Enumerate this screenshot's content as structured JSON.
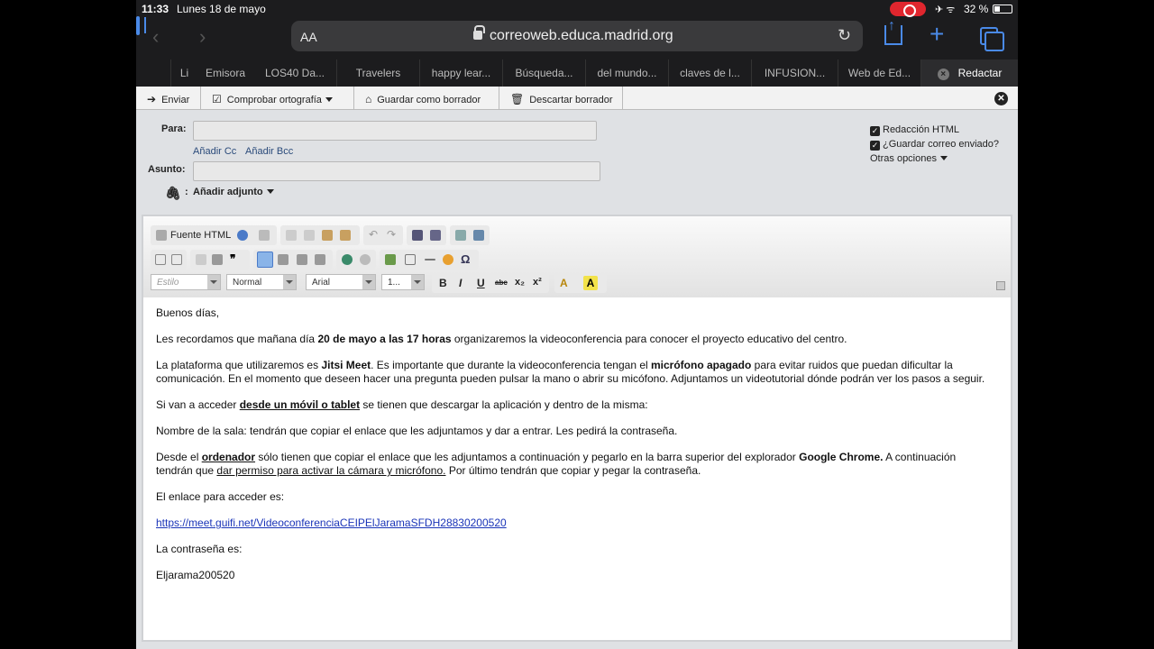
{
  "status": {
    "time": "11:33",
    "date": "Lunes 18 de mayo",
    "battery": "32 %"
  },
  "browser": {
    "aa_label": "AA",
    "url": "correoweb.educa.madrid.org",
    "tabs": [
      "Li",
      "Emisora",
      "LOS40 Da...",
      "Travelers",
      "happy lear...",
      "Búsqueda...",
      "del mundo...",
      "claves de l...",
      "INFUSION...",
      "Web de Ed...",
      "Redactar"
    ]
  },
  "toolbar": {
    "send": "Enviar",
    "spellcheck": "Comprobar ortografía",
    "save_draft": "Guardar como borrador",
    "discard_draft": "Descartar borrador"
  },
  "form": {
    "to_label": "Para:",
    "add_cc": "Añadir Cc",
    "add_bcc": "Añadir Bcc",
    "subject_label": "Asunto:",
    "attach_label": "Añadir adjunto",
    "html_option": "Redacción HTML",
    "save_sent_option": "¿Guardar correo enviado?",
    "other_options": "Otras opciones"
  },
  "editor": {
    "source_html": "Fuente HTML",
    "style_combo": "Estilo",
    "format_combo": "Normal",
    "font_combo": "Arial",
    "size_combo": "1...",
    "bold": "B",
    "italic": "I",
    "underline": "U",
    "strike": "abc",
    "subscript": "x₂",
    "superscript": "x²"
  },
  "message": {
    "greeting": "Buenos días,",
    "p1_a": "Les recordamos que mañana día ",
    "p1_b": "20 de mayo a las 17 horas",
    "p1_c": " organizaremos la videoconferencia para conocer el proyecto educativo del centro.",
    "p2_a": "La plataforma que utilizaremos es ",
    "p2_b": "Jitsi Meet",
    "p2_c": ". Es importante que durante la videoconferencia tengan el ",
    "p2_d": "micrófono apagado",
    "p2_e": " para evitar ruidos que puedan dificultar la comunicación. En el momento que deseen hacer una pregunta pueden pulsar la mano o abrir su micófono. Adjuntamos un videotutorial dónde podrán ver los pasos a seguir.",
    "p3_a": "Si van a acceder ",
    "p3_b": "desde un móvil o tablet",
    "p3_c": " se tienen que descargar la aplicación y dentro de la misma:",
    "p4": "Nombre de la sala: tendrán que copiar el enlace que les adjuntamos y dar a entrar. Les pedirá la contraseña.",
    "p5_a": "Desde el ",
    "p5_b": "ordenador",
    "p5_c": " sólo tienen que copiar el enlace que les adjuntamos a continuación y pegarlo en la barra superior del explorador ",
    "p5_d": "Google Chrome.",
    "p5_e": " A continuación tendrán que ",
    "p5_f": "dar permiso para activar la cámara y micrófono.",
    "p5_g": " Por último tendrán que copiar y pegar la contraseña.",
    "p6": "El enlace para acceder es:",
    "link": "https://meet.guifi.net/VideoconferenciaCEIPElJaramaSFDH28830200520",
    "p7": "La contraseña es:",
    "password": "Eljarama200520"
  }
}
